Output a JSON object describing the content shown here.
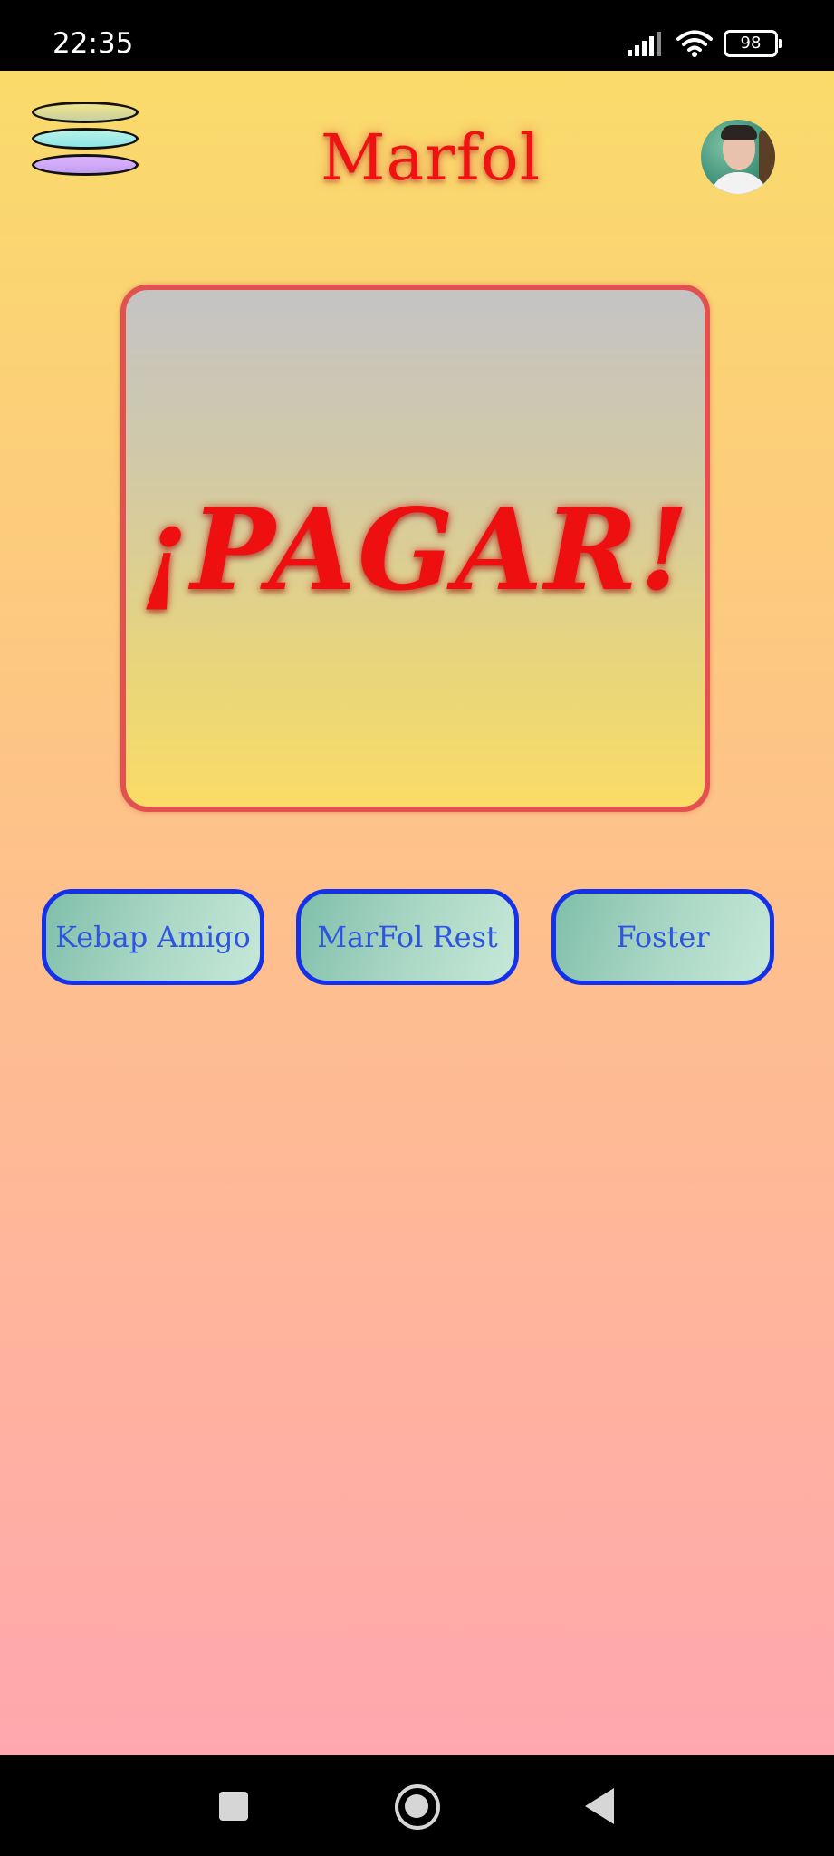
{
  "status_bar": {
    "time": "22:35",
    "battery": "98",
    "icons": [
      "signal-icon",
      "wifi-icon",
      "battery-icon"
    ]
  },
  "header": {
    "title": "Marfol",
    "menu_icon": "stacked-menu-icon",
    "avatar_icon": "user-avatar"
  },
  "main": {
    "pay_button_label": "¡PAGAR!",
    "restaurants": [
      {
        "label": "Kebap Amigo"
      },
      {
        "label": "MarFol Rest"
      },
      {
        "label": "Foster"
      }
    ]
  },
  "nav_bar": {
    "icons": [
      "recents-square-icon",
      "home-circle-icon",
      "back-triangle-icon"
    ]
  },
  "colors": {
    "title": "#ef1212",
    "pay_card_border": "#e2504f",
    "restaurant_border": "#1531e8",
    "restaurant_text": "#2e55e0",
    "background_top": "#fadb6a",
    "background_bottom": "#ffa7ae"
  }
}
